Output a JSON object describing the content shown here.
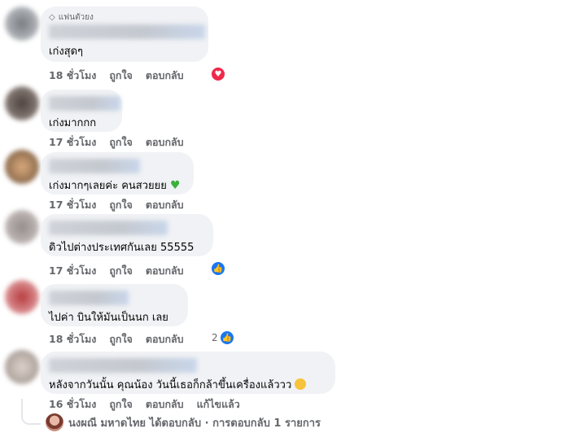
{
  "comments": [
    {
      "badge": "แฟนตัวยง",
      "text": "เก่งสุดๆ",
      "time": "18 ชั่วโมง",
      "like": "ถูกใจ",
      "reply": "ตอบกลับ",
      "reaction": "love",
      "reaction_count": ""
    },
    {
      "text": "เก่งมากกก",
      "time": "17 ชั่วโมง",
      "like": "ถูกใจ",
      "reply": "ตอบกลับ",
      "reaction": "",
      "reaction_count": ""
    },
    {
      "text": "เก่งมากๆเลยค่ะ คนสวยยย",
      "time": "17 ชั่วโมง",
      "like": "ถูกใจ",
      "reply": "ตอบกลับ",
      "reaction": "",
      "reaction_count": ""
    },
    {
      "text": "ดิวไปต่างประเทศกันเลย 55555",
      "time": "17 ชั่วโมง",
      "like": "ถูกใจ",
      "reply": "ตอบกลับ",
      "reaction": "like",
      "reaction_count": ""
    },
    {
      "text": "ไปค่า บินให้มันเป็นนก เลย",
      "time": "18 ชั่วโมง",
      "like": "ถูกใจ",
      "reply": "ตอบกลับ",
      "reaction": "like",
      "reaction_count": "2"
    },
    {
      "text": "หลังจากวันนั้น คุณน้อง วันนี้เธอก็กล้าขึ้นเครื่องแล้ววว",
      "time": "16 ชั่วโมง",
      "like": "ถูกใจ",
      "reply": "ตอบกลับ",
      "edited": "แก้ไขแล้ว",
      "reaction": "",
      "reaction_count": ""
    }
  ],
  "reply_summary": "นงผณี มหาดไทย ได้ตอบกลับ · การตอบกลับ 1 รายการ",
  "colors": {
    "bubble": "#f0f2f5",
    "meta": "#65676b",
    "love": "#f0284a",
    "like": "#1877f2"
  }
}
